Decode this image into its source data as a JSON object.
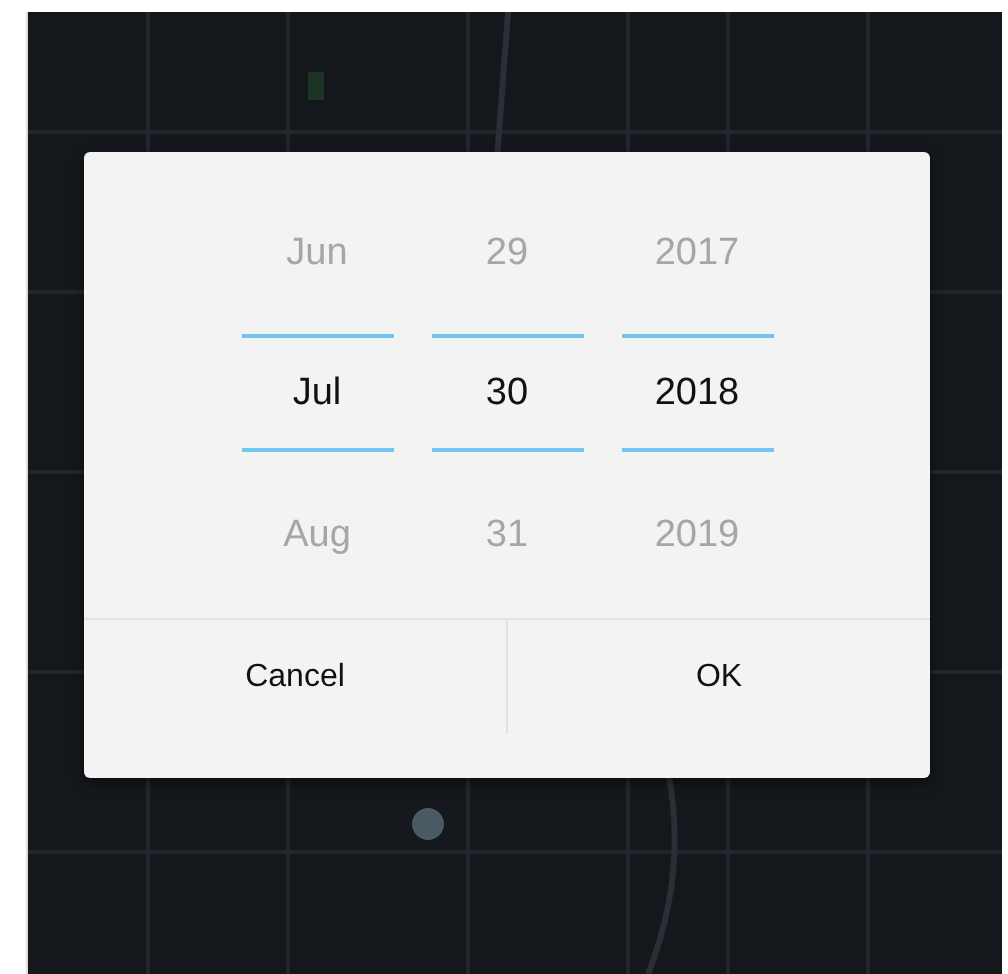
{
  "dialog": {
    "columns": [
      {
        "items": [
          {
            "label": "Jun",
            "selected": false
          },
          {
            "label": "Jul",
            "selected": true
          },
          {
            "label": "Aug",
            "selected": false
          }
        ]
      },
      {
        "items": [
          {
            "label": "29",
            "selected": false
          },
          {
            "label": "30",
            "selected": true
          },
          {
            "label": "31",
            "selected": false
          }
        ]
      },
      {
        "items": [
          {
            "label": "2017",
            "selected": false
          },
          {
            "label": "2018",
            "selected": true
          },
          {
            "label": "2019",
            "selected": false
          }
        ]
      }
    ],
    "buttons": [
      {
        "label": "Cancel"
      },
      {
        "label": "OK"
      }
    ]
  }
}
